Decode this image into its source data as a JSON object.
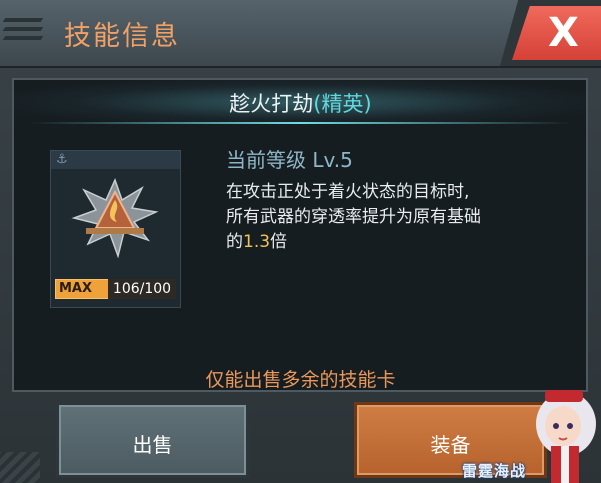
{
  "window": {
    "title": "技能信息",
    "close_label": "X"
  },
  "skill": {
    "name": "趁火打劫",
    "tier": "(精英)",
    "level_label": "当前等级",
    "level_value": "Lv.5",
    "desc_line1": "在攻击正处于着火状态的目标时,",
    "desc_line2": "所有武器的穿透率提升为原有基础",
    "desc_line3_prefix": "的",
    "desc_multiplier": "1.3",
    "desc_line3_suffix": "倍"
  },
  "card": {
    "max_label": "MAX",
    "progress_text": "106/100",
    "icon": "flame-shield-icon"
  },
  "hint": "仅能出售多余的技能卡",
  "buttons": {
    "sell": "出售",
    "equip": "装备"
  },
  "branding": {
    "logo_text": "雷霆海战"
  },
  "colors": {
    "title": "#f1a066",
    "tier": "#61d8de",
    "highlight": "#f3c35b",
    "close": "#e0493d",
    "equip": "#c46f38"
  }
}
